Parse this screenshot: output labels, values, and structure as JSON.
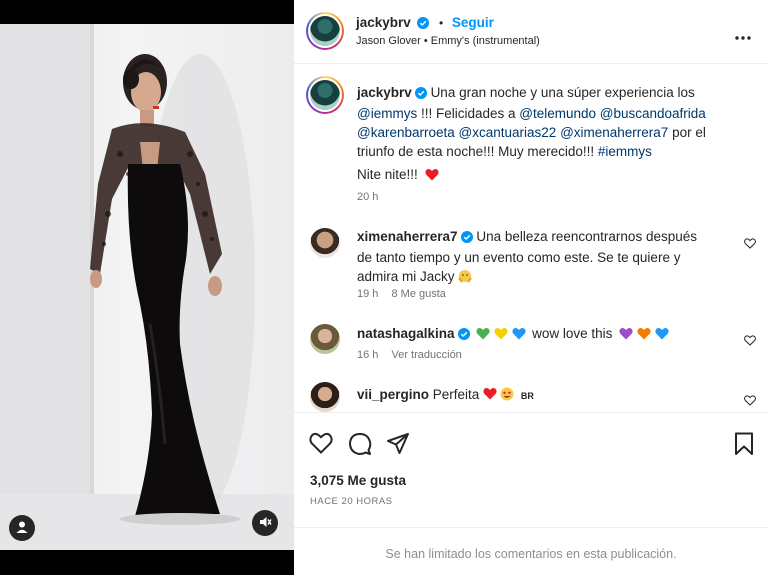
{
  "post": {
    "author": "jackybrv",
    "follow_label": "Seguir",
    "audio": "Jason Glover • Emmy's (instrumental)",
    "caption": {
      "pre": "Una gran noche y una súper experiencia los ",
      "m1": "@iemmys",
      "t1": " !!! Felicidades a ",
      "m2": "@telemundo",
      "m3": "@buscandoafrida",
      "m4": "@karenbarroeta",
      "m5": "@xcantuarias22",
      "m6": "@ximenaherrera7",
      "t2": " por el triunfo de esta noche!!! Muy merecido!!! ",
      "m7": "#iemmys",
      "line2": "Nite nite!!!",
      "time": "20 h"
    },
    "likes": "3,075 Me gusta",
    "posted": "HACE 20 HORAS",
    "footer": "Se han limitado los comentarios en esta publicación."
  },
  "comments": [
    {
      "user": "ximenaherrera7",
      "text": "Una belleza reencontrarnos después de tanto tiempo y un evento como este. Se te quiere y admira mi Jacky",
      "time": "19 h",
      "likes": "8 Me gusta"
    },
    {
      "user": "natashagalkina",
      "text": "wow love this",
      "time": "16 h",
      "translate": "Ver traducción"
    },
    {
      "user": "vii_pergino",
      "text": "Perfeita",
      "tail": "BR"
    }
  ],
  "colors": {
    "accent": "#0095f6",
    "mention": "#00376b",
    "verified": "#0095f6",
    "heart": "#ed4956"
  },
  "icons": [
    "user-tag-icon",
    "mute-icon",
    "more-options-icon",
    "verified-badge-icon",
    "heart-icon",
    "comment-icon",
    "share-icon",
    "save-icon"
  ]
}
